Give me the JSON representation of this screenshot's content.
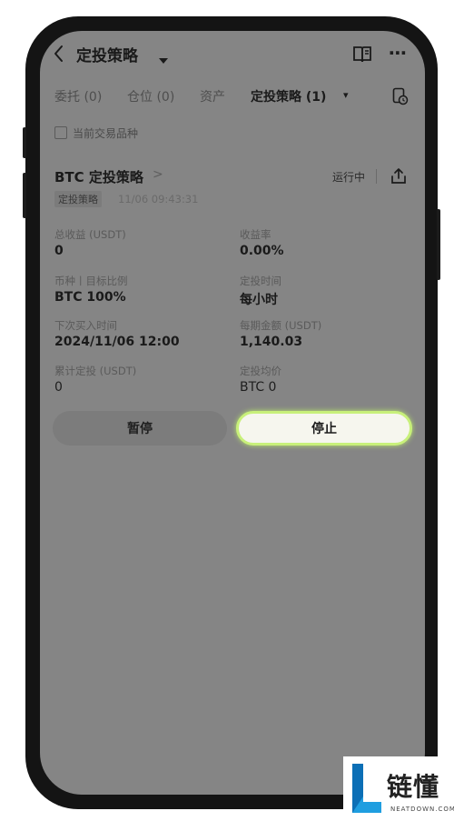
{
  "header": {
    "title": "定投策略",
    "back_icon": "chevron-left-icon",
    "dropdown_icon": "caret-down-icon",
    "book_icon": "book-icon",
    "more_icon": "more-icon",
    "more_glyph": "⋯"
  },
  "tabs": [
    {
      "label": "委托 (0)"
    },
    {
      "label": "仓位 (0)"
    },
    {
      "label": "资产"
    },
    {
      "label": "定投策略 (1)",
      "active": true
    }
  ],
  "tab_caret": "▾",
  "filter": {
    "label": "当前交易品种"
  },
  "strategy": {
    "title": "BTC 定投策略",
    "arrow": ">",
    "status": "运行中",
    "tag": "定投策略",
    "timestamp": "11/06 09:43:31",
    "fields": {
      "total_profit_label": "总收益 (USDT)",
      "total_profit_value": "0",
      "yield_label": "收益率",
      "yield_value": "0.00%",
      "coin_label": "币种丨目标比例",
      "coin_value": "BTC 100%",
      "interval_label": "定投时间",
      "interval_value": "每小时",
      "next_buy_label": "下次买入时间",
      "next_buy_value": "2024/11/06 12:00",
      "amount_label": "每期金额 (USDT)",
      "amount_value": "1,140.03",
      "cumulative_label": "累计定投 (USDT)",
      "cumulative_value": "0",
      "avg_price_label": "定投均价",
      "avg_price_value": "BTC 0"
    }
  },
  "buttons": {
    "pause": "暂停",
    "stop": "停止"
  },
  "watermark": {
    "name": "链懂",
    "sub": "NEATDOWN.COM"
  },
  "colors": {
    "screen_bg": "#858585",
    "stop_highlight": "#c8f07a"
  }
}
